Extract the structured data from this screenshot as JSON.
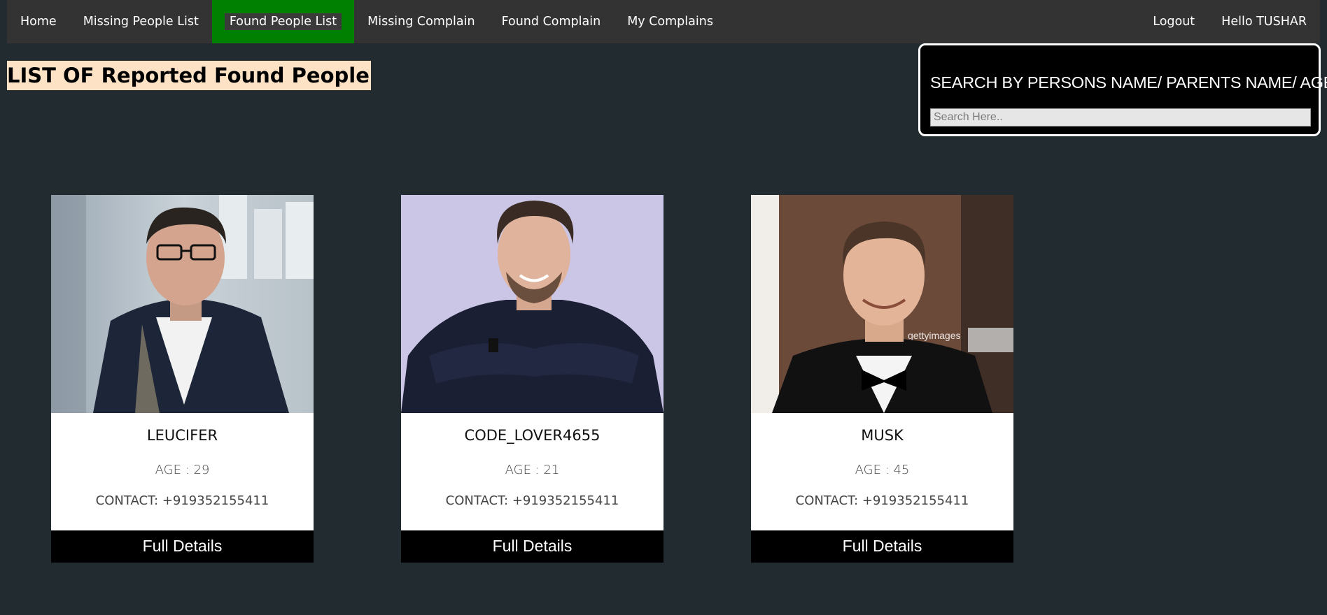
{
  "nav": {
    "left": [
      "Home",
      "Missing People List",
      "Found People List",
      "Missing Complain",
      "Found Complain",
      "My Complains"
    ],
    "right": [
      "Logout",
      "Hello TUSHAR"
    ],
    "active_color": "#008000"
  },
  "page_title": "LIST OF Reported Found People",
  "search": {
    "heading": "SEARCH BY PERSONS NAME/ PARENTS NAME/ AGE",
    "placeholder": "Search Here.."
  },
  "cards": [
    {
      "name": "LEUCIFER",
      "age": "AGE : 29",
      "contact": "CONTACT: +919352155411",
      "button": "Full Details"
    },
    {
      "name": "CODE_LOVER4655",
      "age": "AGE : 21",
      "contact": "CONTACT: +919352155411",
      "button": "Full Details"
    },
    {
      "name": "MUSK",
      "age": "AGE : 45",
      "contact": "CONTACT: +919352155411",
      "button": "Full Details",
      "photo_watermark": "gettyimages"
    }
  ]
}
